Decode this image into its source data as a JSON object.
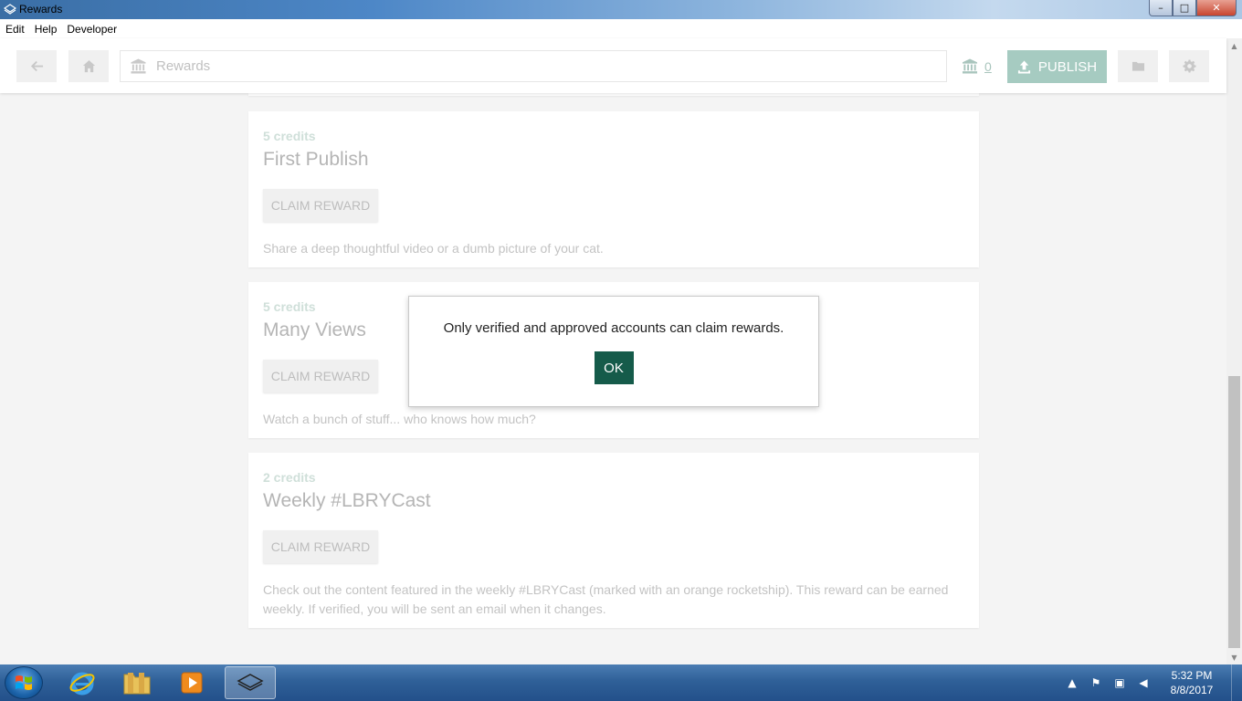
{
  "window": {
    "title": "Rewards",
    "controls": [
      "–",
      "□",
      "✕"
    ]
  },
  "menu": [
    "Edit",
    "Help",
    "Developer"
  ],
  "header": {
    "search_value": "",
    "search_placeholder": "Rewards",
    "balance": "0",
    "publish_label": "PUBLISH"
  },
  "rewards": [
    {
      "credits": "5 credits",
      "title": "First Publish",
      "button": "CLAIM REWARD",
      "description": "Share a deep thoughtful video or a dumb picture of your cat."
    },
    {
      "credits": "5 credits",
      "title": "Many Views",
      "button": "CLAIM REWARD",
      "description": "Watch a bunch of stuff... who knows how much?"
    },
    {
      "credits": "2 credits",
      "title": "Weekly #LBRYCast",
      "button": "CLAIM REWARD",
      "description": "Check out the content featured in the weekly #LBRYCast (marked with an orange rocketship). This reward can be earned weekly. If verified, you will be sent an email when it changes."
    }
  ],
  "modal": {
    "message": "Only verified and approved accounts can claim rewards.",
    "ok_label": "OK"
  },
  "taskbar": {
    "time": "5:32 PM",
    "date": "8/8/2017"
  },
  "icons": {
    "back": "arrow-left-icon",
    "home": "home-icon",
    "wallet": "bank-icon",
    "publish": "upload-icon",
    "files": "folder-icon",
    "settings": "gear-icon"
  }
}
